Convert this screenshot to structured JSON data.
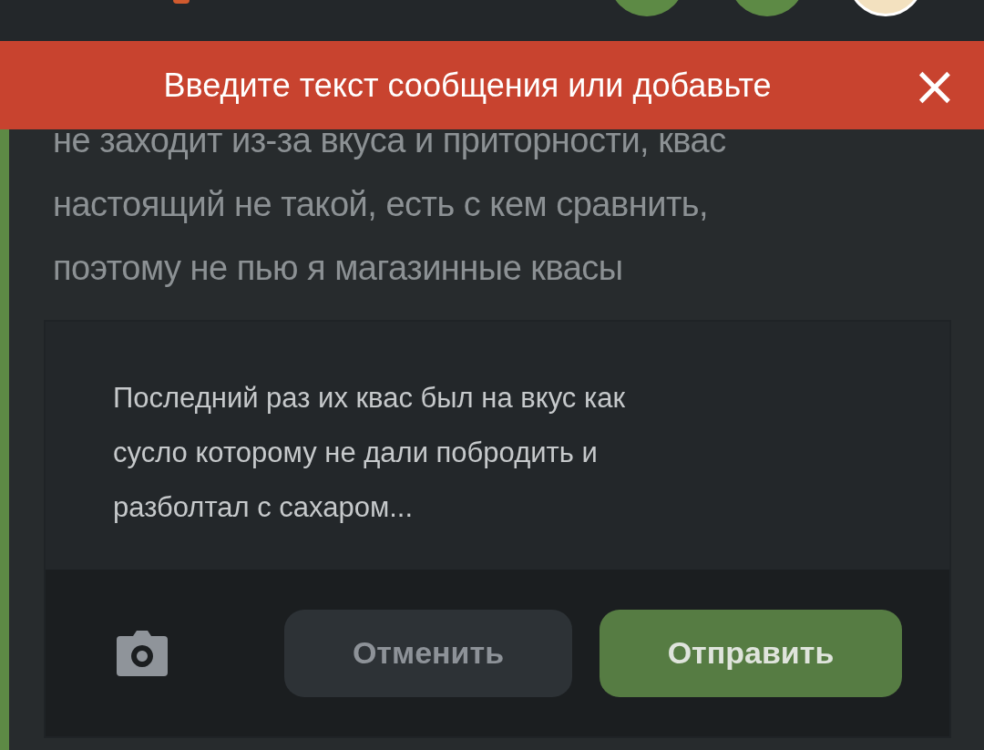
{
  "error_banner": {
    "message": "Введите текст сообщения или добавьте",
    "close_icon": "×"
  },
  "comment": {
    "lines": [
      "не заходит из-за вкуса и приторности, квас",
      "настоящий не такой, есть с кем сравнить,",
      "поэтому не пью я магазинные квасы"
    ]
  },
  "reply_editor": {
    "value_lines": [
      "Последний раз их квас был на вкус как",
      "сусло которому не дали побродить и",
      "разболтал с сахаром..."
    ],
    "buttons": [
      {
        "kind": "cancel",
        "label": "Отменить"
      },
      {
        "kind": "send",
        "label": "Отправить"
      }
    ]
  }
}
